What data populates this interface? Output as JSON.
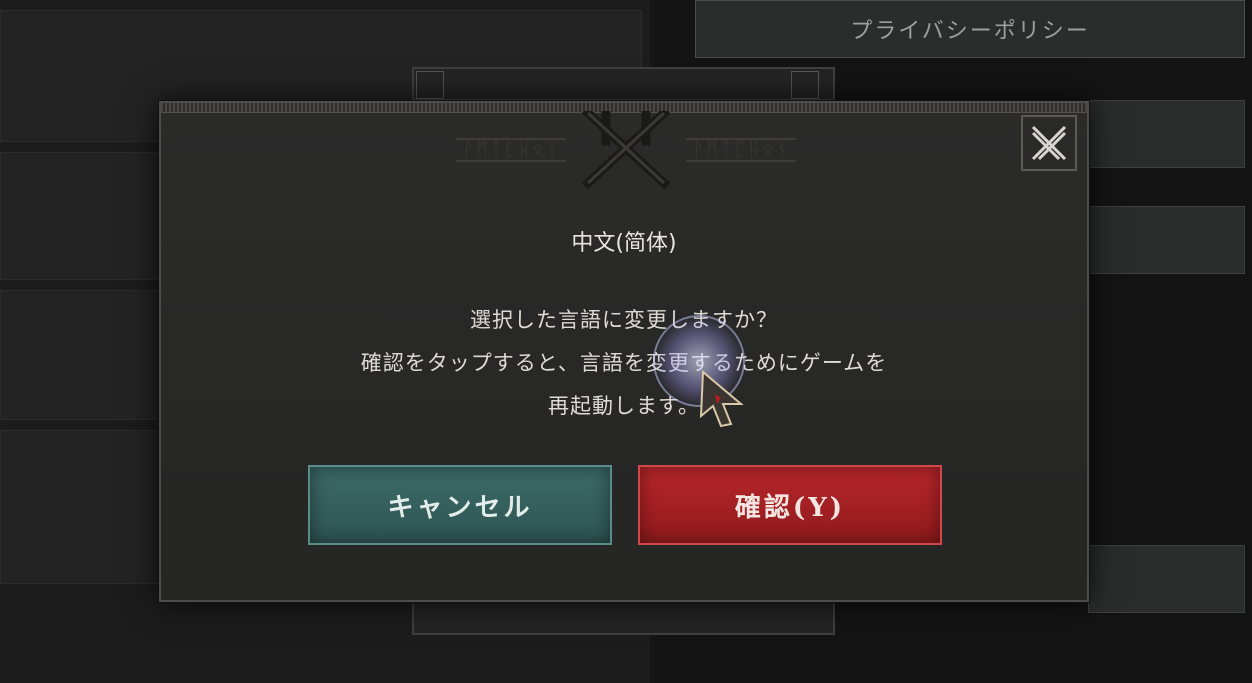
{
  "background": {
    "privacy_button_label": "プライバシーポリシー"
  },
  "dialog": {
    "language_name": "中文(简体)",
    "message_lines": [
      "選択した言語に変更しますか？",
      "確認をタップすると、言語を変更するためにゲームを",
      "再起動します。"
    ],
    "cancel_label": "キャンセル",
    "confirm_label": "確認(Y)",
    "close_icon": "close-x-icon",
    "crest_icon": "rune-crest-icon"
  },
  "colors": {
    "cancel_teal": "#3c6a68",
    "confirm_red": "#b8262a",
    "panel_dark": "#2b2b2a"
  }
}
